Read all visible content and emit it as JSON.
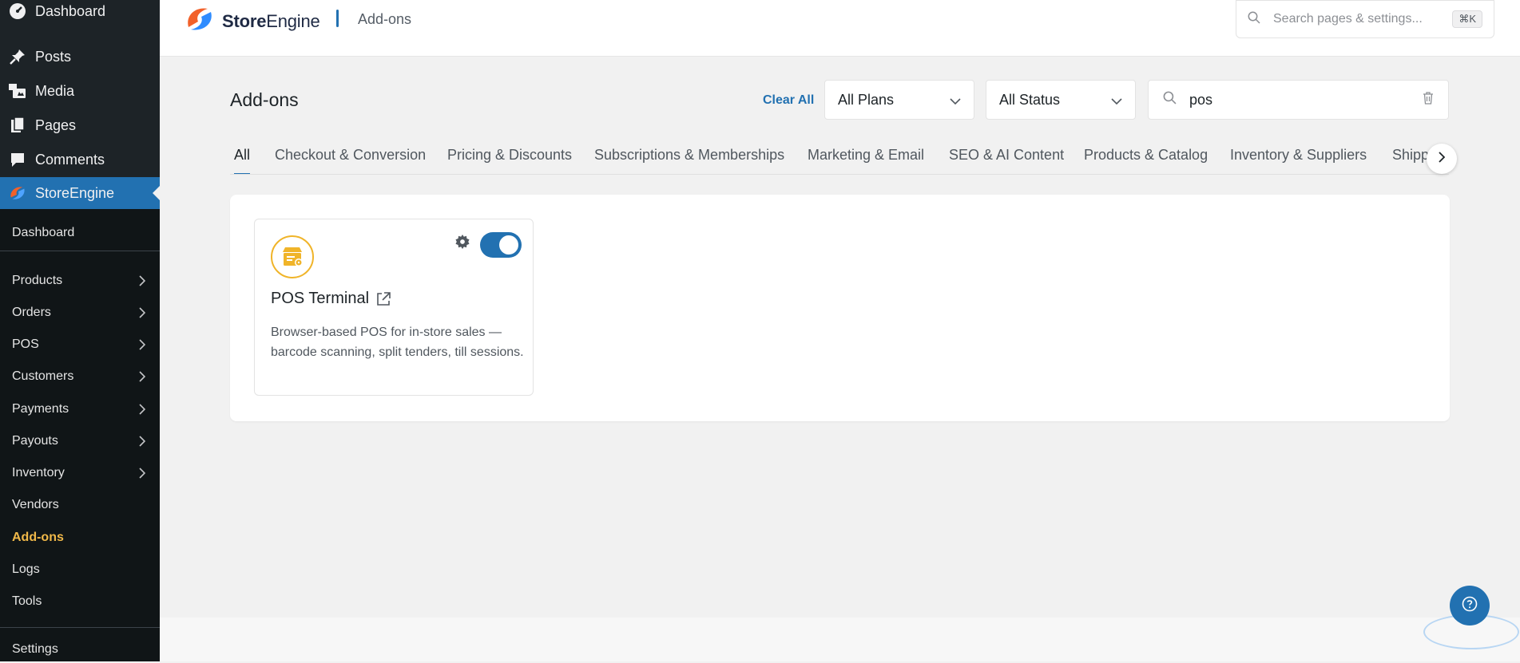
{
  "sidebar": {
    "top_items": [
      {
        "label": "Dashboard",
        "icon": "dashboard-icon"
      },
      {
        "label": "Posts",
        "icon": "pin-icon"
      },
      {
        "label": "Media",
        "icon": "media-icon"
      },
      {
        "label": "Pages",
        "icon": "pages-icon"
      },
      {
        "label": "Comments",
        "icon": "comment-icon"
      },
      {
        "label": "StoreEngine",
        "icon": "storeengine-logo-icon"
      }
    ],
    "sub_items": [
      {
        "label": "Dashboard"
      },
      {
        "label": "Products"
      },
      {
        "label": "Orders"
      },
      {
        "label": "POS"
      },
      {
        "label": "Customers"
      },
      {
        "label": "Payments"
      },
      {
        "label": "Payouts"
      },
      {
        "label": "Inventory"
      },
      {
        "label": "Vendors"
      },
      {
        "label": "Add-ons"
      },
      {
        "label": "Logs"
      },
      {
        "label": "Tools"
      },
      {
        "label": "Settings"
      }
    ]
  },
  "topbar": {
    "brand_bold": "Store",
    "brand_light": "Engine",
    "breadcrumb": "Add-ons",
    "search_placeholder": "Search pages & settings...",
    "shortcut": "⌘K"
  },
  "main": {
    "title": "Add-ons",
    "clear_all": "Clear All",
    "plan_filter": "All Plans",
    "status_filter": "All Status",
    "search_value": "pos",
    "tabs": [
      {
        "label": "All"
      },
      {
        "label": "Checkout & Conversion"
      },
      {
        "label": "Pricing & Discounts"
      },
      {
        "label": "Subscriptions & Memberships"
      },
      {
        "label": "Marketing & Email"
      },
      {
        "label": "SEO & AI Content"
      },
      {
        "label": "Products & Catalog"
      },
      {
        "label": "Inventory & Suppliers"
      },
      {
        "label": "Shipp"
      }
    ],
    "addons": [
      {
        "title": "POS Terminal",
        "description": "Browser-based POS for in-store sales — barcode scanning, split tenders, till sessions.",
        "enabled": true,
        "icon": "pos-store-icon"
      }
    ]
  },
  "colors": {
    "accent": "#2271b1",
    "sidebar_bg": "#1d2327",
    "current_menu": "#f0b849",
    "addon_icon": "#f0b429"
  }
}
